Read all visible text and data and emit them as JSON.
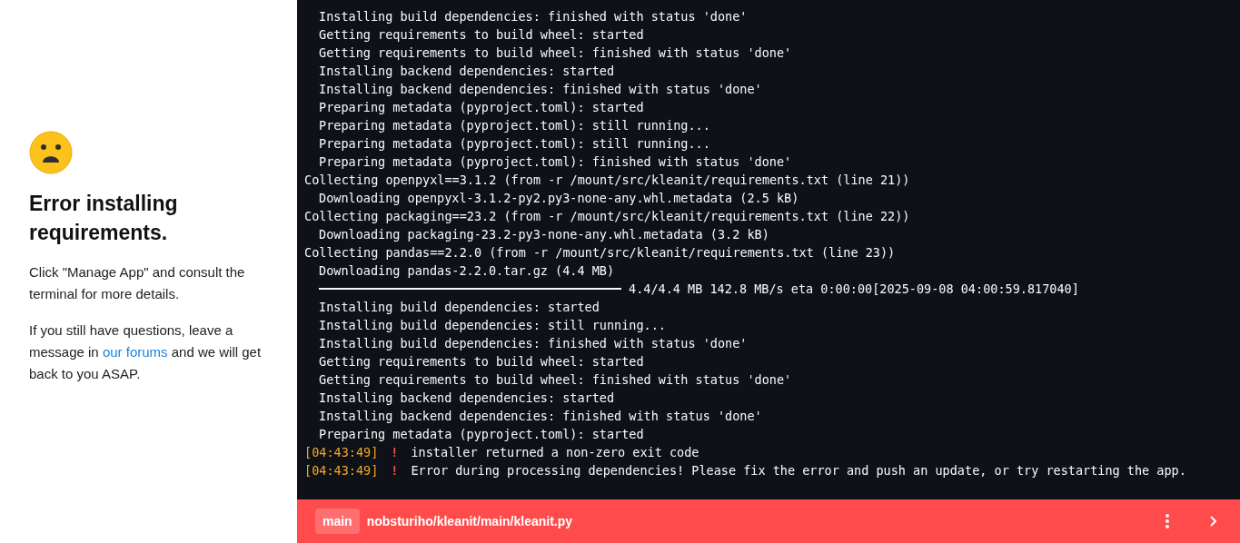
{
  "message": {
    "title": "Error installing requirements.",
    "paragraphs": [
      {
        "text": "Click \"Manage App\" and consult the terminal for more details."
      },
      {
        "before": "If you still have questions, leave a message in ",
        "link": "our forums",
        "after": " and we will get back to you ASAP."
      }
    ]
  },
  "terminal": {
    "lines": [
      {
        "kind": "sub",
        "text": "Installing build dependencies: finished with status 'done'"
      },
      {
        "kind": "sub",
        "text": "Getting requirements to build wheel: started"
      },
      {
        "kind": "sub",
        "text": "Getting requirements to build wheel: finished with status 'done'"
      },
      {
        "kind": "sub",
        "text": "Installing backend dependencies: started"
      },
      {
        "kind": "sub",
        "text": "Installing backend dependencies: finished with status 'done'"
      },
      {
        "kind": "sub",
        "text": "Preparing metadata (pyproject.toml): started"
      },
      {
        "kind": "sub",
        "text": "Preparing metadata (pyproject.toml): still running..."
      },
      {
        "kind": "sub",
        "text": "Preparing metadata (pyproject.toml): still running..."
      },
      {
        "kind": "sub",
        "text": "Preparing metadata (pyproject.toml): finished with status 'done'"
      },
      {
        "kind": "top",
        "text": "Collecting openpyxl==3.1.2 (from -r /mount/src/kleanit/requirements.txt (line 21))"
      },
      {
        "kind": "sub",
        "text": "Downloading openpyxl-3.1.2-py2.py3-none-any.whl.metadata (2.5 kB)"
      },
      {
        "kind": "top",
        "text": "Collecting packaging==23.2 (from -r /mount/src/kleanit/requirements.txt (line 22))"
      },
      {
        "kind": "sub",
        "text": "Downloading packaging-23.2-py3-none-any.whl.metadata (3.2 kB)"
      },
      {
        "kind": "top",
        "text": "Collecting pandas==2.2.0 (from -r /mount/src/kleanit/requirements.txt (line 23))"
      },
      {
        "kind": "sub",
        "text": "Downloading pandas-2.2.0.tar.gz (4.4 MB)"
      },
      {
        "kind": "progress",
        "level": 1,
        "text": "4.4/4.4 MB 142.8 MB/s eta 0:00:00[2025-09-08 04:00:59.817040]"
      },
      {
        "kind": "sub",
        "text": "Installing build dependencies: started"
      },
      {
        "kind": "sub",
        "text": "Installing build dependencies: still running..."
      },
      {
        "kind": "sub",
        "text": "Installing build dependencies: finished with status 'done'"
      },
      {
        "kind": "sub",
        "text": "Getting requirements to build wheel: started"
      },
      {
        "kind": "sub",
        "text": "Getting requirements to build wheel: finished with status 'done'"
      },
      {
        "kind": "sub",
        "text": "Installing backend dependencies: started"
      },
      {
        "kind": "sub",
        "text": "Installing backend dependencies: finished with status 'done'"
      },
      {
        "kind": "sub",
        "text": "Preparing metadata (pyproject.toml): started"
      },
      {
        "kind": "error",
        "time": "[04:43:49]",
        "mark": "!",
        "text": "installer returned a non-zero exit code"
      },
      {
        "kind": "error",
        "time": "[04:43:49]",
        "mark": "!",
        "text": "Error during processing dependencies! Please fix the error and push an update, or try restarting the app."
      }
    ]
  },
  "status_bar": {
    "branch": "main",
    "path": "nobsturiho/kleanit/main/kleanit.py"
  }
}
